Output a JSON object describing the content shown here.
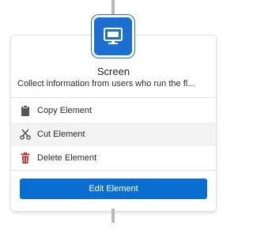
{
  "node": {
    "title": "Screen",
    "description": "Collect information from users who run the fl...",
    "icon": "screen-icon",
    "accent_color": "#1b6fd0"
  },
  "menu": {
    "items": [
      {
        "label": "Copy Element",
        "icon": "clipboard-icon"
      },
      {
        "label": "Cut Element",
        "icon": "scissors-icon"
      },
      {
        "label": "Delete Element",
        "icon": "trash-icon",
        "icon_color": "#c23934"
      }
    ]
  },
  "edit_button": {
    "label": "Edit Element",
    "color": "#0a6ed1"
  }
}
